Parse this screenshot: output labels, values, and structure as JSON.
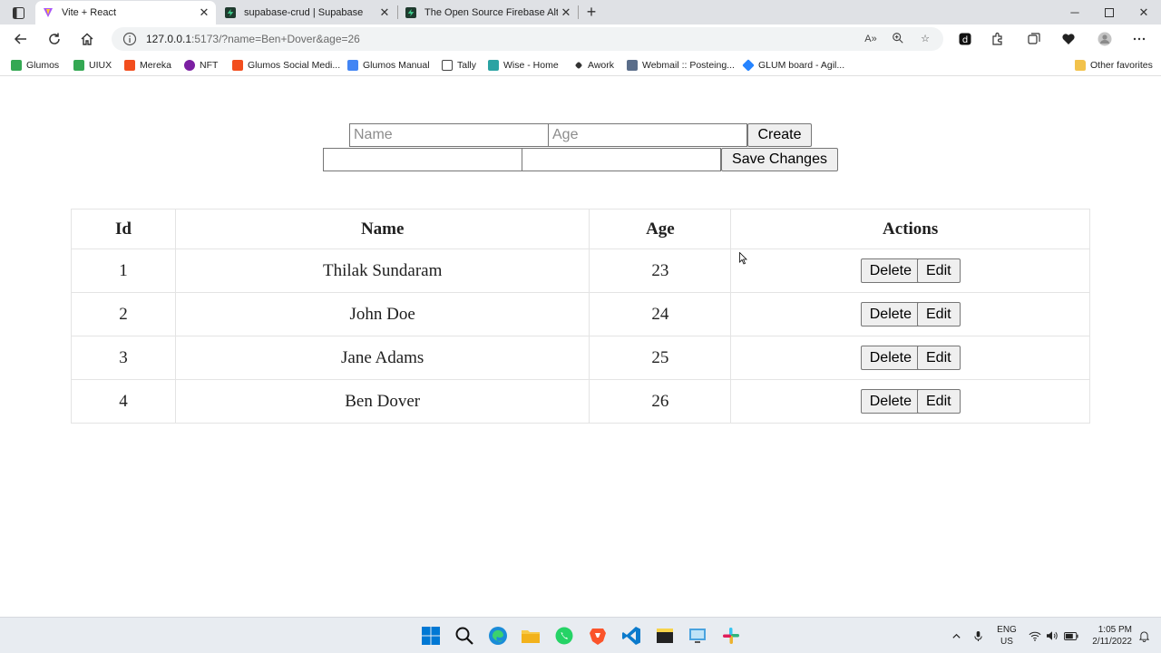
{
  "browser": {
    "tabs": [
      {
        "title": "Vite + React",
        "active": true,
        "color": "#a855f7"
      },
      {
        "title": "supabase-crud | Supabase",
        "active": false,
        "color": "#1f3b2e"
      },
      {
        "title": "The Open Source Firebase Altern",
        "active": false,
        "color": "#1f3b2e"
      }
    ],
    "address": {
      "host": "127.0.0.1",
      "rest": ":5173/?name=Ben+Dover&age=26"
    },
    "bookmarks": [
      {
        "label": "Glumos",
        "color": "#34a853"
      },
      {
        "label": "UIUX",
        "color": "#34a853"
      },
      {
        "label": "Mereka",
        "color": "#f24e1e"
      },
      {
        "label": "NFT",
        "color": "#7b1fa2"
      },
      {
        "label": "Glumos Social Medi...",
        "color": "#f24e1e"
      },
      {
        "label": "Glumos Manual",
        "color": "#4285f4"
      },
      {
        "label": "Tally",
        "color": "#ffffff"
      },
      {
        "label": "Wise - Home",
        "color": "#2ba3a3"
      },
      {
        "label": "Awork",
        "color": "#333333"
      },
      {
        "label": "Webmail :: Posteing...",
        "color": "#5a6d8a"
      },
      {
        "label": "GLUM board - Agil...",
        "color": "#2684ff"
      }
    ],
    "other_favorites": "Other favorites"
  },
  "create_form": {
    "name_placeholder": "Name",
    "age_placeholder": "Age",
    "create_label": "Create"
  },
  "edit_form": {
    "name_value": "",
    "age_value": "",
    "save_label": "Save Changes"
  },
  "table": {
    "headers": [
      "Id",
      "Name",
      "Age",
      "Actions"
    ],
    "rows": [
      {
        "id": "1",
        "name": "Thilak Sundaram",
        "age": "23"
      },
      {
        "id": "2",
        "name": "John Doe",
        "age": "24"
      },
      {
        "id": "3",
        "name": "Jane Adams",
        "age": "25"
      },
      {
        "id": "4",
        "name": "Ben Dover",
        "age": "26"
      }
    ],
    "delete_label": "Delete",
    "edit_label": "Edit"
  },
  "taskbar": {
    "language": "ENG",
    "region": "US",
    "time": "1:05 PM",
    "date": "2/11/2022"
  }
}
